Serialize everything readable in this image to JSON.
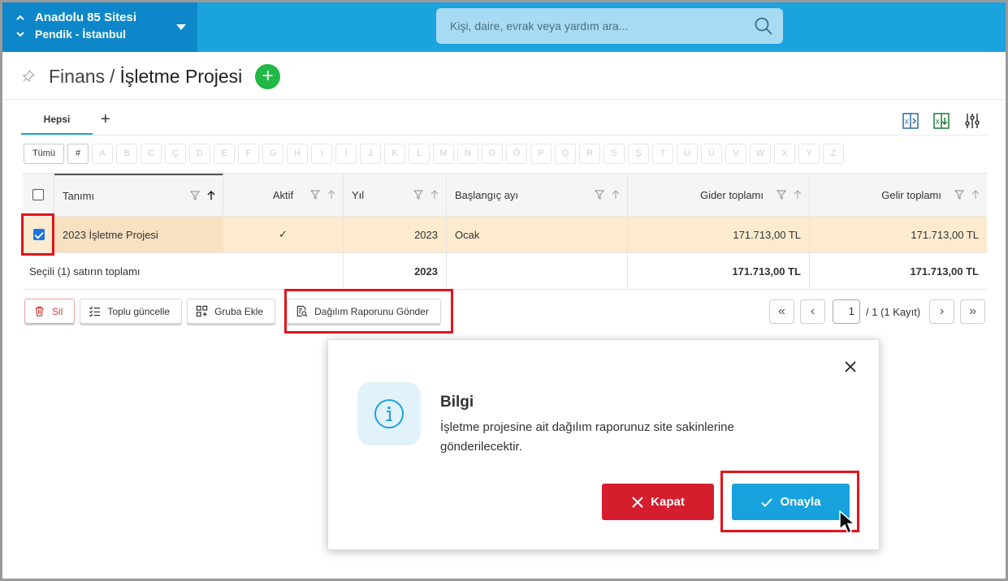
{
  "header": {
    "site_name": "Anadolu 85 Sitesi",
    "site_location": "Pendik - İstanbul",
    "search_placeholder": "Kişi, daire, evrak veya yardım ara..."
  },
  "page": {
    "breadcrumb_parent": "Finans",
    "breadcrumb_separator": "/",
    "breadcrumb_current": "İşletme Projesi"
  },
  "tabs": {
    "active": "Hepsi",
    "add": "+"
  },
  "toolbar_icons": [
    "excel-import-icon",
    "excel-export-icon",
    "column-settings-icon"
  ],
  "letter_filter": {
    "all": "Tümü",
    "hash": "#",
    "letters": [
      "A",
      "B",
      "C",
      "Ç",
      "D",
      "E",
      "F",
      "G",
      "H",
      "I",
      "İ",
      "J",
      "K",
      "L",
      "M",
      "N",
      "O",
      "Ö",
      "P",
      "Q",
      "R",
      "S",
      "Ş",
      "T",
      "U",
      "Ü",
      "V",
      "W",
      "X",
      "Y",
      "Z"
    ]
  },
  "table": {
    "columns": {
      "tanim": "Tanımı",
      "aktif": "Aktif",
      "yil": "Yıl",
      "baslangic": "Başlangıç ayı",
      "gider": "Gider toplamı",
      "gelir": "Gelir toplamı"
    },
    "rows": [
      {
        "tanim": "2023 İşletme Projesi",
        "aktif": "✓",
        "yil": "2023",
        "baslangic": "Ocak",
        "gider": "171.713,00 TL",
        "gelir": "171.713,00 TL",
        "selected": true
      }
    ],
    "summary": {
      "label": "Seçili (1) satırın toplamı",
      "yil": "2023",
      "gider": "171.713,00 TL",
      "gelir": "171.713,00 TL"
    }
  },
  "actions": {
    "sil": "Sil",
    "toplu_guncelle": "Toplu güncelle",
    "gruba_ekle": "Gruba Ekle",
    "dagilim_gonder": "Dağılım Raporunu Gönder"
  },
  "pager": {
    "page": "1",
    "info": "/ 1 (1 Kayıt)"
  },
  "modal": {
    "title": "Bilgi",
    "message": "İşletme projesine ait dağılım raporunuz site sakinlerine gönderilecektir.",
    "cancel": "Kapat",
    "confirm": "Onayla"
  },
  "colors": {
    "primary": "#1ba3de",
    "header_dark": "#0d87c9",
    "danger": "#d51d2d",
    "success": "#22b845",
    "selected_row": "#fdebcf",
    "highlight": "#e4141b"
  }
}
